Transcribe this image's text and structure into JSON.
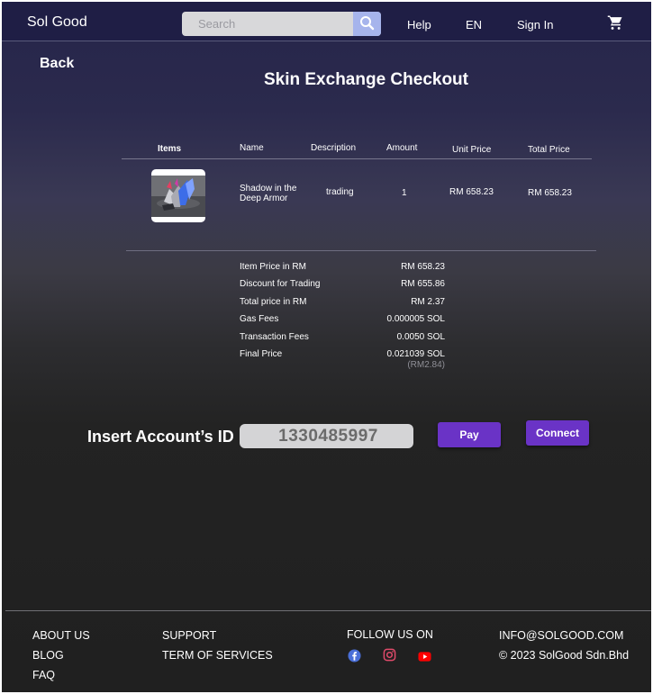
{
  "header": {
    "brand": "Sol Good",
    "search_placeholder": "Search",
    "nav": {
      "help": "Help",
      "lang": "EN",
      "signin": "Sign In"
    }
  },
  "page": {
    "back": "Back",
    "title": "Skin Exchange Checkout"
  },
  "table": {
    "headers": [
      "Items",
      "Name",
      "Description",
      "Amount",
      "Unit Price",
      "Total Price"
    ],
    "row": {
      "name_line1": "Shadow in the",
      "name_line2": "Deep Armor",
      "description": "trading",
      "amount": "1",
      "unit_price": "RM 658.23",
      "total_price": "RM 658.23"
    }
  },
  "summary": [
    {
      "label": "Item Price in RM",
      "value": "RM 658.23"
    },
    {
      "label": "Discount for Trading",
      "value": "RM 655.86"
    },
    {
      "label": "Total price in RM",
      "value": "RM 2.37"
    },
    {
      "label": "Gas Fees",
      "value": "0.000005 SOL"
    },
    {
      "label": "Transaction Fees",
      "value": "0.0050 SOL"
    },
    {
      "label": "Final Price",
      "value": "0.021039 SOL",
      "sub": "(RM2.84)"
    }
  ],
  "account": {
    "label": "Insert Account’s ID",
    "value": "1330485997",
    "pay": "Pay",
    "connect": "Connect"
  },
  "footer": {
    "col1": [
      "ABOUT US",
      "BLOG",
      "FAQ"
    ],
    "col2": [
      "SUPPORT",
      "TERM OF SERVICES"
    ],
    "follow": "FOLLOW US ON",
    "email": "INFO@SOLGOOD.COM",
    "copyright": "© 2023 SolGood Sdn.Bhd",
    "social_icons": [
      "facebook-icon",
      "instagram-icon",
      "youtube-icon"
    ]
  },
  "colors": {
    "header_bg": "#1f1e45",
    "accent_button": "#6a33c6",
    "search_button": "#a6b4ec",
    "facebook": "#4a6fd8",
    "instagram": "#e04a6a",
    "youtube": "#ff0000"
  }
}
